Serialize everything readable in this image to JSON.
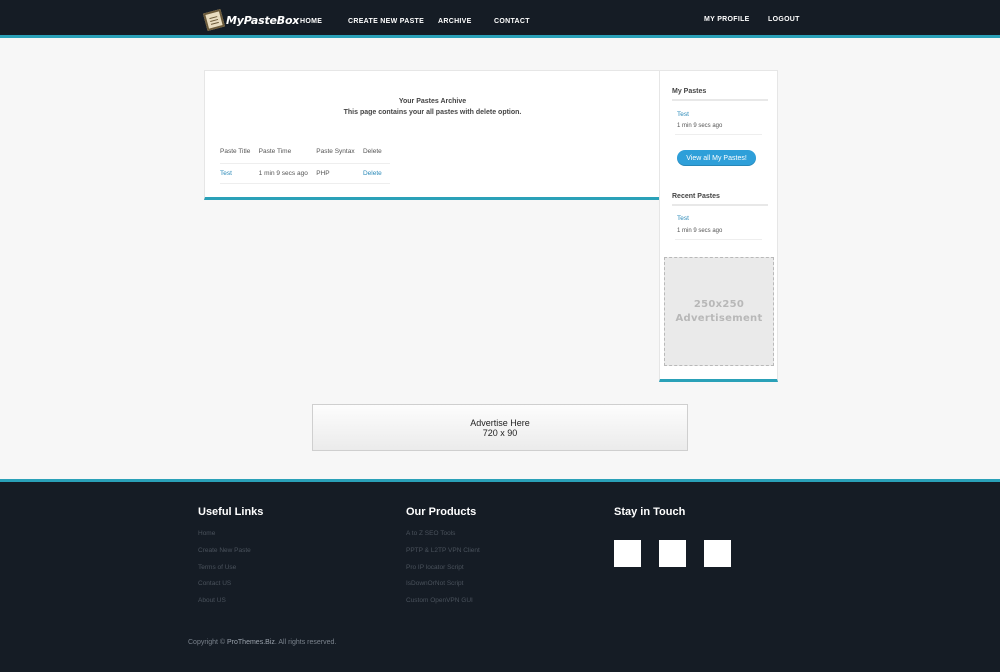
{
  "header": {
    "logo_text": "MyPasteBox",
    "nav": {
      "home": "HOME",
      "create": "CREATE NEW PASTE",
      "archive": "ARCHIVE",
      "contact": "CONTACT",
      "profile": "MY PROFILE",
      "logout": "LOGOUT"
    }
  },
  "main": {
    "title": "Your Pastes Archive",
    "description": "This page contains your all pastes with delete option.",
    "table": {
      "headers": [
        "Paste Title",
        "Paste Time",
        "Paste Syntax",
        "Delete"
      ],
      "rows": [
        {
          "title": "Test",
          "time": "1 min 9 secs ago",
          "syntax": "PHP",
          "delete": "Delete"
        }
      ]
    }
  },
  "sidebar": {
    "my_pastes_heading": "My Pastes",
    "my_pastes": [
      {
        "title": "Test",
        "time": "1 min 9 secs ago"
      }
    ],
    "view_all_button": "View all My Pastes!",
    "recent_heading": "Recent Pastes",
    "recent_pastes": [
      {
        "title": "Test",
        "time": "1 min 9 secs ago"
      }
    ],
    "ad": {
      "line1": "250x250",
      "line2": "Advertisement"
    }
  },
  "banner_ad": {
    "line1": "Advertise Here",
    "line2": "720 x 90"
  },
  "footer": {
    "useful_links_heading": "Useful Links",
    "useful_links": [
      "Home",
      "Create New Paste",
      "Terms of Use",
      "Contact US",
      "About US"
    ],
    "products_heading": "Our Products",
    "products": [
      "A to Z SEO Tools",
      "PPTP & L2TP VPN Client",
      "Pro IP locator Script",
      "IsDownOrNot Script",
      "Custom OpenVPN GUI"
    ],
    "stay_heading": "Stay in Touch",
    "copyright_prefix": "Copyright ©",
    "copyright_brand": "ProThemes.Biz",
    "copyright_suffix": ". All rights reserved."
  },
  "colors": {
    "header_bg": "#151c25",
    "accent": "#2aa1b8",
    "link": "#2a89b8",
    "button": "#2e9fd9"
  }
}
